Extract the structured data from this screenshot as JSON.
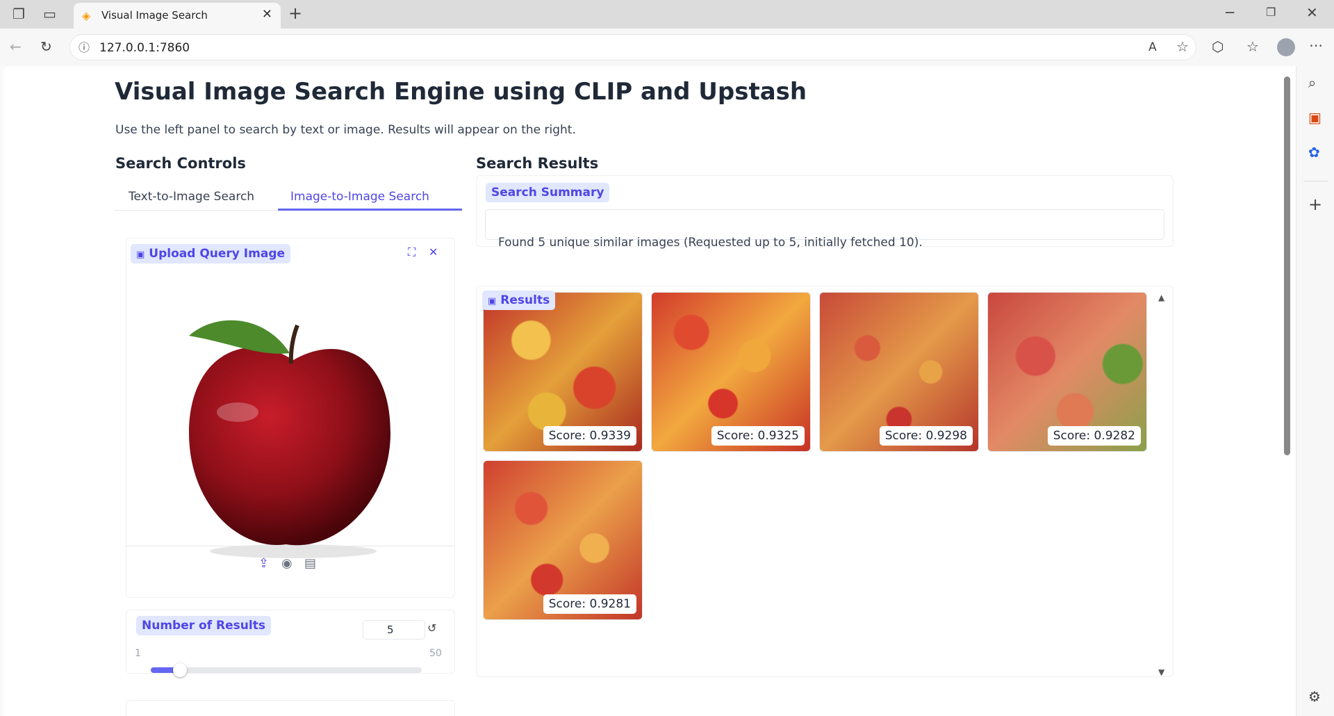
{
  "browser": {
    "tab_title": "Visual Image Search",
    "url": "127.0.0.1:7860"
  },
  "page": {
    "title": "Visual Image Search Engine using CLIP and Upstash",
    "description": "Use the left panel to search by text or image. Results will appear on the right."
  },
  "controls": {
    "heading": "Search Controls",
    "tabs": [
      {
        "label": "Text-to-Image Search",
        "active": false
      },
      {
        "label": "Image-to-Image Search",
        "active": true
      }
    ],
    "upload_label": "Upload Query Image",
    "num_results_label": "Number of Results",
    "num_results_value": "5",
    "slider_min": "1",
    "slider_max": "50",
    "slider_level": 0.082
  },
  "results": {
    "heading": "Search Results",
    "summary_label": "Search Summary",
    "summary_text": "Found 5 unique similar images (Requested up to 5, initially fetched 10).",
    "gallery_label": "Results",
    "items": [
      {
        "score": "Score: 0.9339"
      },
      {
        "score": "Score: 0.9325"
      },
      {
        "score": "Score: 0.9298"
      },
      {
        "score": "Score: 0.9282"
      },
      {
        "score": "Score: 0.9281"
      }
    ]
  },
  "colors": {
    "accent": "#6366f1",
    "label_bg": "#e0e7ff"
  }
}
